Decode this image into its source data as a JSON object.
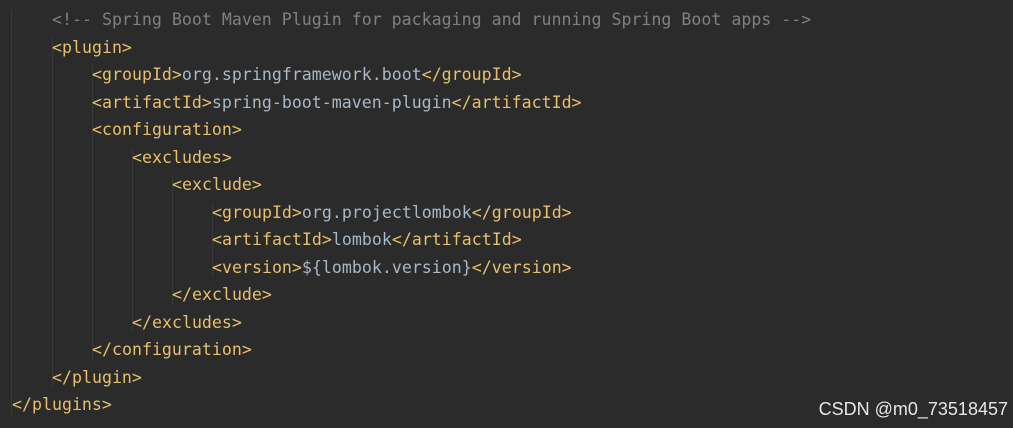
{
  "editor": {
    "lines": [
      {
        "indent": 2,
        "parts": [
          {
            "t": "cmt",
            "s": "<!-- Spring Boot Maven Plugin for packaging and running Spring Boot apps -->"
          }
        ]
      },
      {
        "indent": 2,
        "parts": [
          {
            "t": "tag",
            "s": "<plugin>"
          }
        ]
      },
      {
        "indent": 3,
        "parts": [
          {
            "t": "tag",
            "s": "<groupId>"
          },
          {
            "t": "txt",
            "s": "org.springframework.boot"
          },
          {
            "t": "tag",
            "s": "</groupId>"
          }
        ]
      },
      {
        "indent": 3,
        "parts": [
          {
            "t": "tag",
            "s": "<artifactId>"
          },
          {
            "t": "txt",
            "s": "spring-boot-maven-plugin"
          },
          {
            "t": "tag",
            "s": "</artifactId>"
          }
        ]
      },
      {
        "indent": 3,
        "parts": [
          {
            "t": "tag",
            "s": "<configuration>"
          }
        ]
      },
      {
        "indent": 4,
        "parts": [
          {
            "t": "tag",
            "s": "<excludes>"
          }
        ]
      },
      {
        "indent": 5,
        "parts": [
          {
            "t": "tag",
            "s": "<exclude>"
          }
        ]
      },
      {
        "indent": 6,
        "parts": [
          {
            "t": "tag",
            "s": "<groupId>"
          },
          {
            "t": "txt",
            "s": "org.projectlombok"
          },
          {
            "t": "tag",
            "s": "</groupId>"
          }
        ]
      },
      {
        "indent": 6,
        "parts": [
          {
            "t": "tag",
            "s": "<artifactId>"
          },
          {
            "t": "txt",
            "s": "lombok"
          },
          {
            "t": "tag",
            "s": "</artifactId>"
          }
        ]
      },
      {
        "indent": 6,
        "parts": [
          {
            "t": "tag",
            "s": "<version>"
          },
          {
            "t": "txt",
            "s": "${lombok.version}"
          },
          {
            "t": "tag",
            "s": "</version>"
          }
        ]
      },
      {
        "indent": 5,
        "parts": [
          {
            "t": "tag",
            "s": "</exclude>"
          }
        ]
      },
      {
        "indent": 4,
        "parts": [
          {
            "t": "tag",
            "s": "</excludes>"
          }
        ]
      },
      {
        "indent": 3,
        "parts": [
          {
            "t": "tag",
            "s": "</configuration>"
          }
        ]
      },
      {
        "indent": 2,
        "parts": [
          {
            "t": "tag",
            "s": "</plugin>"
          }
        ]
      },
      {
        "indent": 1,
        "parts": [
          {
            "t": "tag",
            "s": "</plugins>"
          }
        ]
      }
    ]
  },
  "watermark": "CSDN @m0_73518457",
  "colors": {
    "background": "#2b2b2b",
    "tag": "#e8bf6a",
    "text": "#a9b7c6",
    "comment": "#808080"
  }
}
